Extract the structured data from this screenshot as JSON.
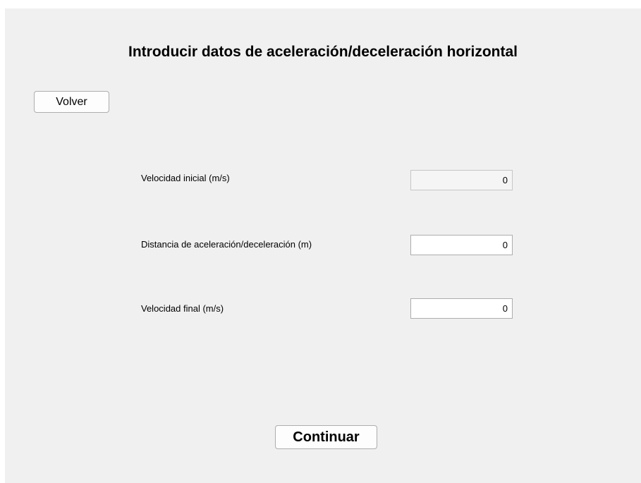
{
  "title": "Introducir datos de aceleración/deceleración horizontal",
  "buttons": {
    "back_label": "Volver",
    "continue_label": "Continuar"
  },
  "fields": [
    {
      "label": "Velocidad inicial (m/s)",
      "value": "0",
      "editable": false
    },
    {
      "label": "Distancia de aceleración/deceleración (m)",
      "value": "0",
      "editable": true
    },
    {
      "label": "Velocidad final (m/s)",
      "value": "0",
      "editable": true
    }
  ]
}
